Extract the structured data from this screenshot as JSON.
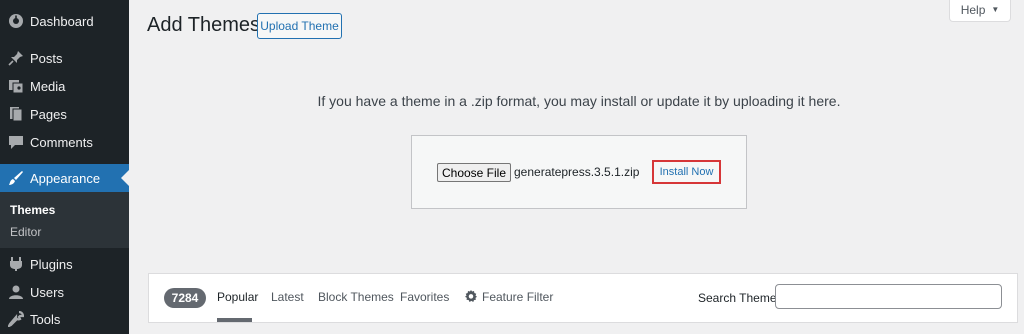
{
  "sidebar": {
    "items": [
      {
        "label": "Dashboard",
        "icon": "dashboard-icon"
      },
      {
        "label": "Posts",
        "icon": "pin-icon"
      },
      {
        "label": "Media",
        "icon": "media-icon"
      },
      {
        "label": "Pages",
        "icon": "pages-icon"
      },
      {
        "label": "Comments",
        "icon": "comments-icon"
      },
      {
        "label": "Appearance",
        "icon": "brush-icon"
      },
      {
        "label": "Plugins",
        "icon": "plugin-icon"
      },
      {
        "label": "Users",
        "icon": "users-icon"
      },
      {
        "label": "Tools",
        "icon": "wrench-icon"
      }
    ],
    "submenu": [
      {
        "label": "Themes"
      },
      {
        "label": "Editor"
      }
    ]
  },
  "header": {
    "title": "Add Themes",
    "upload_button": "Upload Theme",
    "help_label": "Help"
  },
  "upload": {
    "description": "If you have a theme in a .zip format, you may install or update it by uploading it here.",
    "choose_file_label": "Choose File",
    "file_name": "generatepress.3.5.1.zip",
    "install_label": "Install Now"
  },
  "filter": {
    "count": "7284",
    "links": [
      "Popular",
      "Latest",
      "Block Themes",
      "Favorites",
      "Feature Filter"
    ],
    "search_label": "Search Themes",
    "search_value": ""
  },
  "colors": {
    "sidebar_bg": "#1d2327",
    "accent": "#2271b1",
    "highlight_border": "#d63638"
  }
}
